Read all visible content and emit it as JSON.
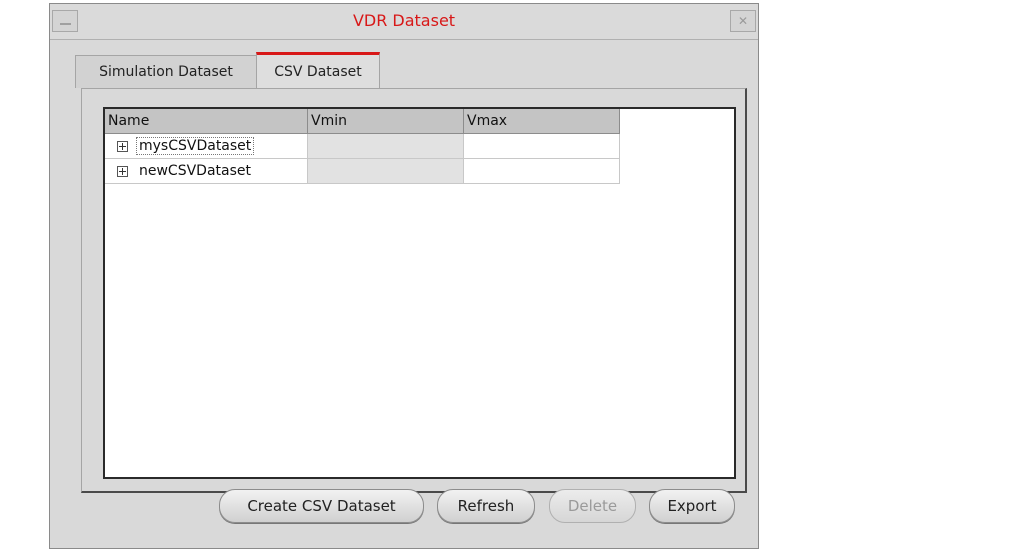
{
  "window": {
    "title": "VDR Dataset",
    "close_glyph": "✕"
  },
  "tabs": [
    {
      "label": "Simulation Dataset",
      "active": false
    },
    {
      "label": "CSV Dataset",
      "active": true
    }
  ],
  "table": {
    "columns": [
      "Name",
      "Vmin",
      "Vmax"
    ],
    "rows": [
      {
        "name": "mysCSVDataset",
        "vmin": "",
        "vmax": ""
      },
      {
        "name": "newCSVDataset",
        "vmin": "",
        "vmax": ""
      }
    ]
  },
  "buttons": {
    "create": "Create CSV Dataset",
    "refresh": "Refresh",
    "delete": "Delete",
    "export": "Export"
  },
  "colors": {
    "title": "#d81818",
    "active_tab_accent": "#d81818"
  }
}
